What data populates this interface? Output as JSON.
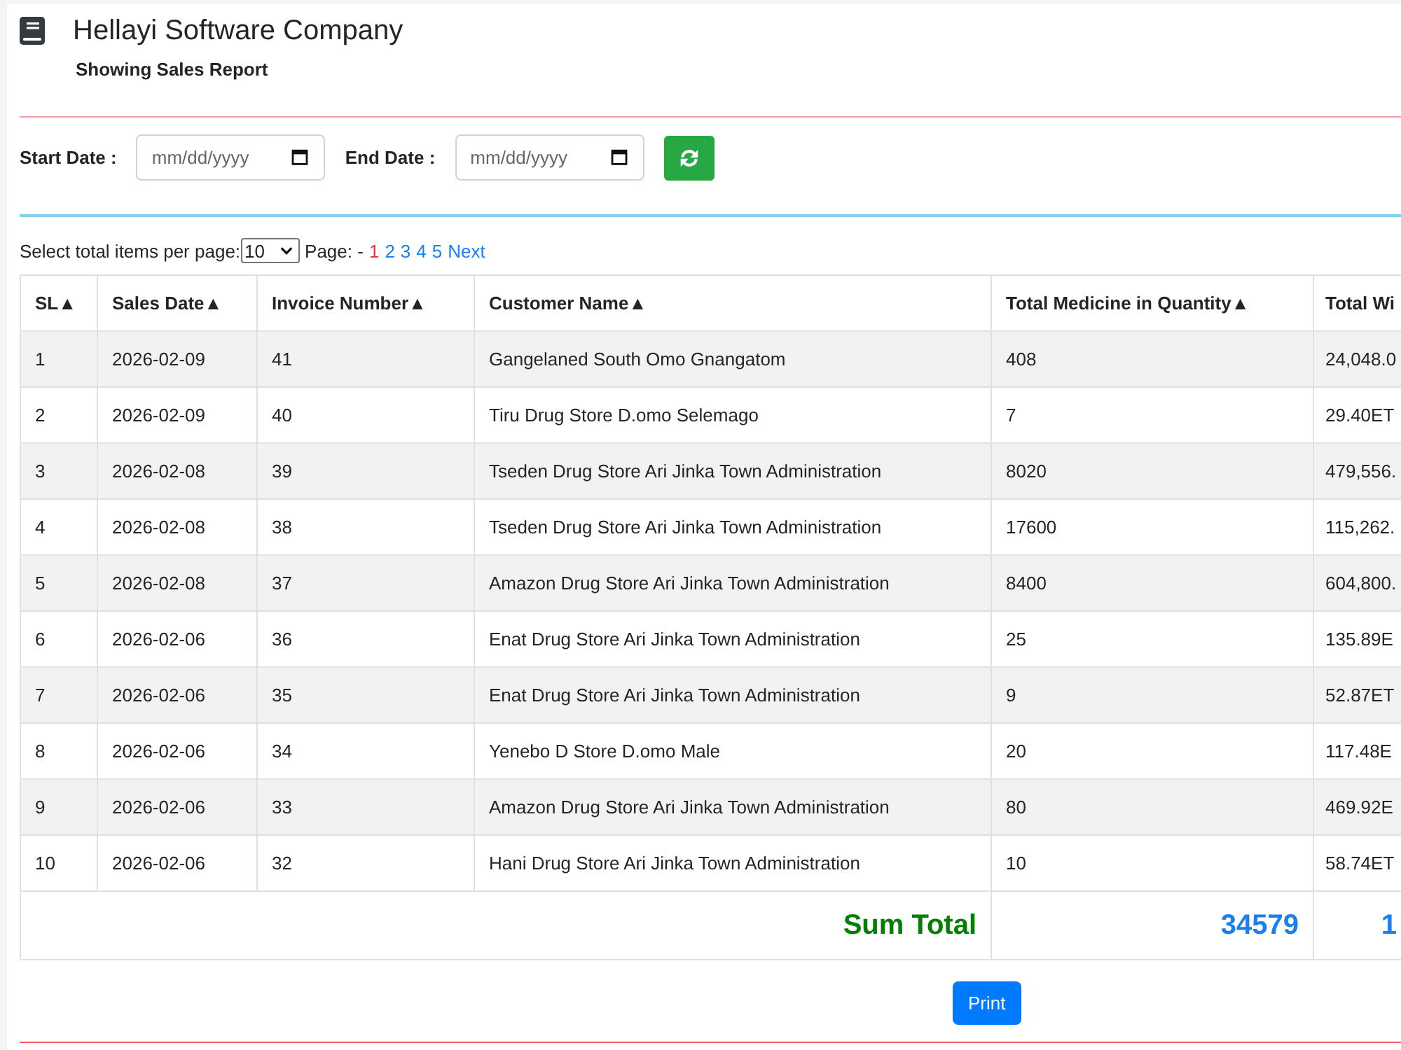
{
  "header": {
    "title": "Hellayi Software Company",
    "subtitle": "Showing Sales Report"
  },
  "filters": [
    {
      "label": "Start Date :",
      "placeholder": "mm/dd/yyyy"
    },
    {
      "label": "End Date :",
      "placeholder": "mm/dd/yyyy"
    }
  ],
  "pagination": {
    "label": "Select total items per page:",
    "page_size": "10",
    "page_label": "Page: -",
    "pages": [
      {
        "label": "1",
        "selected": true
      },
      {
        "label": "2",
        "selected": false
      },
      {
        "label": "3",
        "selected": false
      },
      {
        "label": "4",
        "selected": false
      },
      {
        "label": "5",
        "selected": false
      }
    ],
    "next": "Next"
  },
  "table": {
    "columns": [
      "SL▲",
      "Sales Date▲",
      "Invoice Number▲",
      "Customer Name▲",
      "Total Medicine in Quantity▲",
      "Total Wi"
    ],
    "rows": [
      [
        "1",
        "2026-02-09",
        "41",
        "Gangelaned South Omo Gnangatom",
        "408",
        "24,048.0"
      ],
      [
        "2",
        "2026-02-09",
        "40",
        "Tiru Drug Store D.omo Selemago",
        "7",
        "29.40ET"
      ],
      [
        "3",
        "2026-02-08",
        "39",
        "Tseden Drug Store Ari Jinka Town Administration",
        "8020",
        "479,556."
      ],
      [
        "4",
        "2026-02-08",
        "38",
        "Tseden Drug Store Ari Jinka Town Administration",
        "17600",
        "115,262."
      ],
      [
        "5",
        "2026-02-08",
        "37",
        "Amazon Drug Store Ari Jinka Town Administration",
        "8400",
        "604,800."
      ],
      [
        "6",
        "2026-02-06",
        "36",
        "Enat Drug Store Ari Jinka Town Administration",
        "25",
        "135.89E"
      ],
      [
        "7",
        "2026-02-06",
        "35",
        "Enat Drug Store Ari Jinka Town Administration",
        "9",
        "52.87ET"
      ],
      [
        "8",
        "2026-02-06",
        "34",
        "Yenebo D Store D.omo Male",
        "20",
        "117.48E"
      ],
      [
        "9",
        "2026-02-06",
        "33",
        "Amazon Drug Store Ari Jinka Town Administration",
        "80",
        "469.92E"
      ],
      [
        "10",
        "2026-02-06",
        "32",
        "Hani Drug Store Ari Jinka Town Administration",
        "10",
        "58.74ET"
      ]
    ],
    "totals": {
      "label": "Sum Total",
      "values": [
        "34579",
        "1"
      ]
    }
  },
  "print_button": "Print"
}
